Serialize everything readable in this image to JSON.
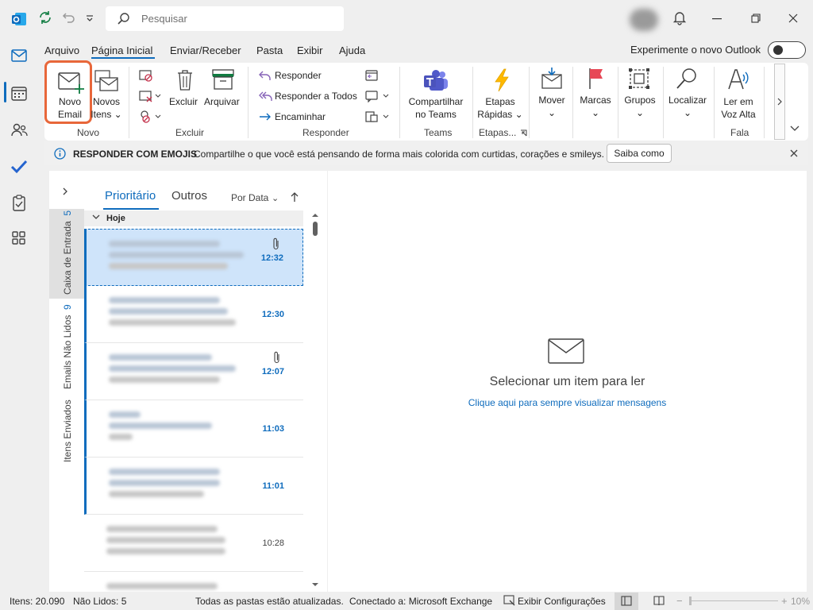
{
  "title_bar": {
    "search_placeholder": "Pesquisar",
    "icons": [
      "outlook-logo-icon",
      "sync-icon",
      "undo-icon",
      "customize-dropdown-icon",
      "search-icon",
      "avatar",
      "bell-icon",
      "minimize-icon",
      "restore-icon",
      "close-icon"
    ]
  },
  "menu": {
    "items": [
      "Arquivo",
      "Página Inicial",
      "Enviar/Receber",
      "Pasta",
      "Exibir",
      "Ajuda"
    ],
    "selected": "Página Inicial",
    "try_new": "Experimente o novo Outlook"
  },
  "ribbon": {
    "novo_email": [
      "Novo",
      "Email"
    ],
    "novos_itens": [
      "Novos",
      "Itens"
    ],
    "excluir": "Excluir",
    "arquivar": "Arquivar",
    "responder": "Responder",
    "responder_todos": "Responder a Todos",
    "encaminhar": "Encaminhar",
    "compartilhar": [
      "Compartilhar",
      "no Teams"
    ],
    "etapas": [
      "Etapas",
      "Rápidas"
    ],
    "mover": "Mover",
    "marcas": "Marcas",
    "grupos": "Grupos",
    "localizar": "Localizar",
    "ler": [
      "Ler em",
      "Voz Alta"
    ],
    "groups": {
      "novo": "Novo",
      "excluir": "Excluir",
      "responder": "Responder",
      "teams": "Teams",
      "etapas": "Etapas...",
      "fala": "Fala"
    }
  },
  "infobar": {
    "title": "RESPONDER COM EMOJIS",
    "text": "Compartilhe o que você está pensando de forma mais colorida com curtidas, corações e smileys.",
    "button": "Saiba como"
  },
  "folders": {
    "inbox": "Caixa de Entrada",
    "inbox_count": "5",
    "unread": "Emails Não Lidos",
    "unread_count": "9",
    "sent": "Itens Enviados"
  },
  "list": {
    "tab_focused": "Prioritário",
    "tab_other": "Outros",
    "sort": "Por Data",
    "group": "Hoje",
    "messages": [
      {
        "time": "12:32",
        "attachment": true,
        "unread": true,
        "selected": true
      },
      {
        "time": "12:30",
        "attachment": false,
        "unread": true,
        "selected": false
      },
      {
        "time": "12:07",
        "attachment": true,
        "unread": true,
        "selected": false
      },
      {
        "time": "11:03",
        "attachment": false,
        "unread": true,
        "selected": false
      },
      {
        "time": "11:01",
        "attachment": false,
        "unread": true,
        "selected": false
      },
      {
        "time": "10:28",
        "attachment": false,
        "unread": false,
        "selected": false
      }
    ]
  },
  "reading": {
    "empty_message": "Selecionar um item para ler",
    "link": "Clique aqui para sempre visualizar mensagens"
  },
  "status": {
    "items": "Itens: 20.090",
    "unread": "Não Lidos: 5",
    "updated": "Todas as pastas estão atualizadas.",
    "connected": "Conectado a: Microsoft Exchange",
    "settings": "Exibir Configurações",
    "zoom": "10%"
  },
  "colors": {
    "accent": "#0f6cbd",
    "highlight": "#e8673a",
    "selected_row": "#cfe4fa"
  }
}
